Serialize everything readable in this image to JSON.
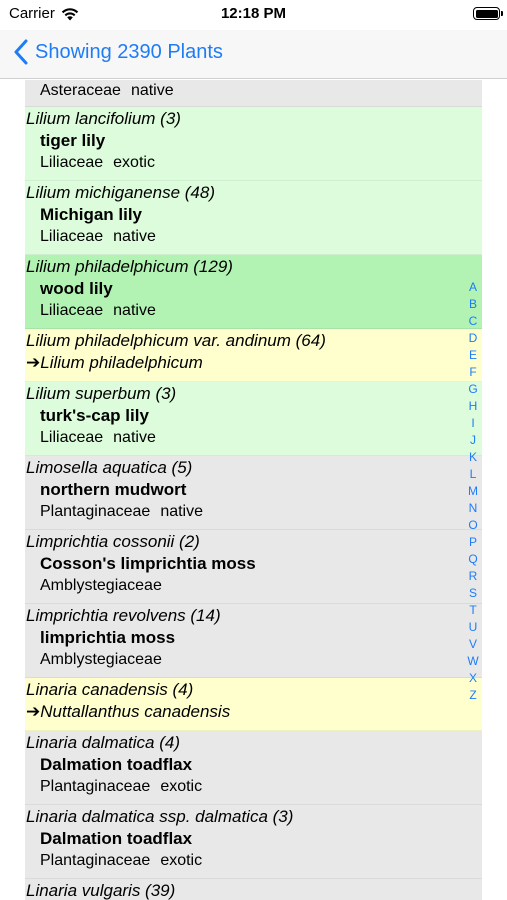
{
  "status_bar": {
    "carrier": "Carrier",
    "time": "12:18 PM"
  },
  "nav": {
    "back_label": "Showing 2390 Plants"
  },
  "colors": {
    "accent": "#1e7cf6",
    "native_row": "#dcfcdc",
    "selected_row": "#b2f2b2",
    "synonym_row": "#ffffce",
    "other_row": "#e8e8e8"
  },
  "top_partial": {
    "family": "Asteraceae",
    "status": "native"
  },
  "plants": [
    {
      "scientific": "Lilium lancifolium  (3)",
      "common": "tiger lily",
      "family": "Liliaceae",
      "status": "exotic"
    },
    {
      "scientific": "Lilium michiganense  (48)",
      "common": "Michigan lily",
      "family": "Liliaceae",
      "status": "native"
    },
    {
      "scientific": "Lilium philadelphicum  (129)",
      "common": "wood lily",
      "family": "Liliaceae",
      "status": "native"
    },
    {
      "scientific": "Lilium philadelphicum var. andinum  (64)",
      "redirect": "➔Lilium philadelphicum"
    },
    {
      "scientific": "Lilium superbum  (3)",
      "common": "turk's-cap lily",
      "family": "Liliaceae",
      "status": "native"
    },
    {
      "scientific": "Limosella aquatica  (5)",
      "common": "northern mudwort",
      "family": "Plantaginaceae",
      "status": "native"
    },
    {
      "scientific": "Limprichtia cossonii  (2)",
      "common": "Cosson's limprichtia moss",
      "family": "Amblystegiaceae",
      "status": ""
    },
    {
      "scientific": "Limprichtia revolvens  (14)",
      "common": "limprichtia moss",
      "family": "Amblystegiaceae",
      "status": ""
    },
    {
      "scientific": "Linaria canadensis  (4)",
      "redirect": "➔Nuttallanthus canadensis"
    },
    {
      "scientific": "Linaria dalmatica  (4)",
      "common": "Dalmation toadflax",
      "family": "Plantaginaceae",
      "status": "exotic"
    },
    {
      "scientific": "Linaria dalmatica ssp. dalmatica  (3)",
      "common": "Dalmation toadflax",
      "family": "Plantaginaceae",
      "status": "exotic"
    },
    {
      "scientific": "Linaria vulgaris  (39)"
    }
  ],
  "index_letters": [
    "A",
    "B",
    "C",
    "D",
    "E",
    "F",
    "G",
    "H",
    "I",
    "J",
    "K",
    "L",
    "M",
    "N",
    "O",
    "P",
    "Q",
    "R",
    "S",
    "T",
    "U",
    "V",
    "W",
    "X",
    "Z"
  ]
}
